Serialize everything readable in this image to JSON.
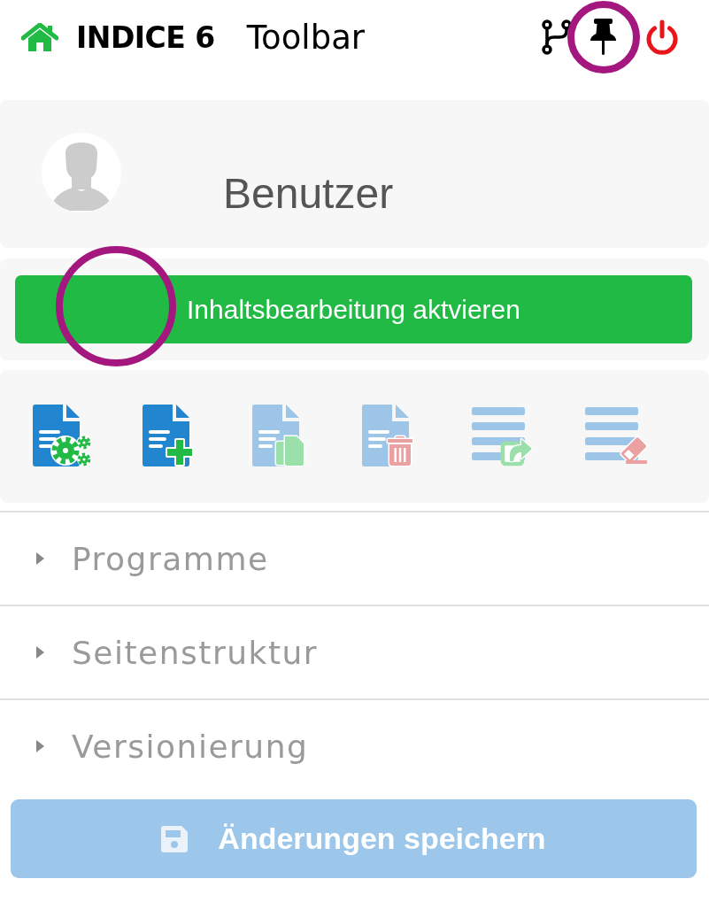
{
  "header": {
    "title": "INDICE 6",
    "subtitle": "Toolbar",
    "actions": [
      {
        "kind": "branch",
        "highlighted": false
      },
      {
        "kind": "pin",
        "highlighted": true
      },
      {
        "kind": "power",
        "highlighted": false
      }
    ]
  },
  "user": {
    "name": "Benutzer"
  },
  "activate_button": {
    "label": "Inhaltsbearbeitung aktvieren",
    "highlighted": true
  },
  "tools": [
    {
      "kind": "document-settings",
      "disabled": false
    },
    {
      "kind": "document-add",
      "disabled": false
    },
    {
      "kind": "document-copy",
      "disabled": true
    },
    {
      "kind": "document-delete",
      "disabled": true
    },
    {
      "kind": "list-export",
      "disabled": true
    },
    {
      "kind": "list-clear",
      "disabled": true
    }
  ],
  "sections": [
    {
      "label": "Programme",
      "expanded": false
    },
    {
      "label": "Seitenstruktur",
      "expanded": false
    },
    {
      "label": "Versionierung",
      "expanded": false
    }
  ],
  "save_button": {
    "label": "Änderungen speichern",
    "disabled": true
  }
}
